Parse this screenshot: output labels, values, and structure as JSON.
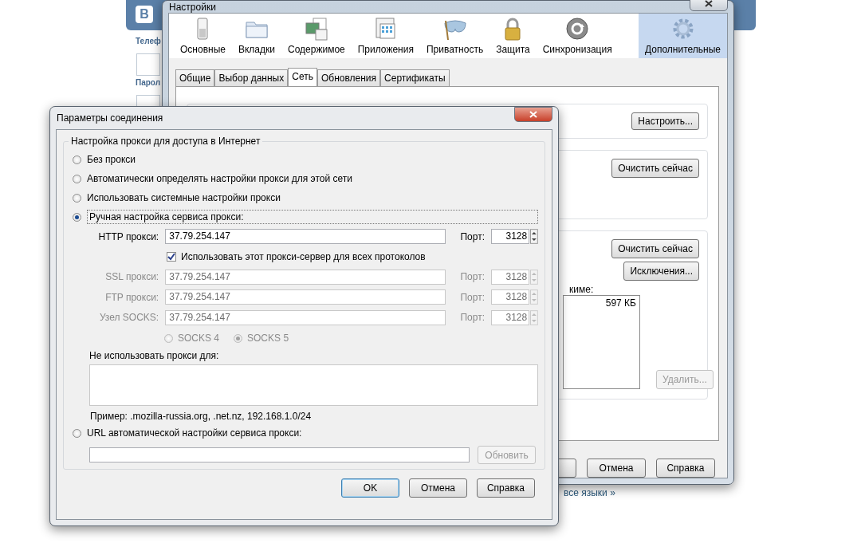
{
  "background_page": {
    "logo": "В",
    "phone_label": "Телеф",
    "password_label": "Парол",
    "languages_link": "все языки »"
  },
  "settings_window": {
    "title": "Настройки",
    "categories": [
      {
        "label": "Основные",
        "selected": false
      },
      {
        "label": "Вкладки",
        "selected": false
      },
      {
        "label": "Содержимое",
        "selected": false
      },
      {
        "label": "Приложения",
        "selected": false
      },
      {
        "label": "Приватность",
        "selected": false
      },
      {
        "label": "Защита",
        "selected": false
      },
      {
        "label": "Синхронизация",
        "selected": false
      },
      {
        "label": "Дополнительные",
        "selected": true
      }
    ],
    "tabs": [
      {
        "label": "Общие",
        "selected": false
      },
      {
        "label": "Выбор данных",
        "selected": false
      },
      {
        "label": "Сеть",
        "selected": true
      },
      {
        "label": "Обновления",
        "selected": false
      },
      {
        "label": "Сертификаты",
        "selected": false
      }
    ],
    "connection_button": "Настроить...",
    "cache_button": "Очистить сейчас",
    "offline_clear_button": "Очистить сейчас",
    "exceptions_button": "Исключения...",
    "offline_label": "киме:",
    "offline_list": {
      "size": "597 КБ"
    },
    "remove_button": {
      "label": "Удалить...",
      "disabled": true
    },
    "footer_buttons": [
      "Отмена",
      "Справка"
    ]
  },
  "connection_dialog": {
    "title": "Параметры соединения",
    "group_title": "Настройка прокси для доступа в Интернет",
    "modes": [
      {
        "label": "Без прокси",
        "selected": false
      },
      {
        "label": "Автоматически определять настройки прокси для этой сети",
        "selected": false
      },
      {
        "label": "Использовать системные настройки прокси",
        "selected": false
      },
      {
        "label": "Ручная настройка сервиса прокси:",
        "selected": true
      }
    ],
    "proxies": [
      {
        "label": "HTTP прокси:",
        "value": "37.79.254.147",
        "port_label": "Порт:",
        "port": "3128",
        "disabled": false
      }
    ],
    "same_proxy": {
      "label": "Использовать этот прокси-сервер для всех протоколов",
      "checked": true
    },
    "other_proxies": [
      {
        "label": "SSL прокси:",
        "value": "37.79.254.147",
        "port_label": "Порт:",
        "port": "3128",
        "disabled": true
      },
      {
        "label": "FTP прокси:",
        "value": "37.79.254.147",
        "port_label": "Порт:",
        "port": "3128",
        "disabled": true
      },
      {
        "label": "Узел SOCKS:",
        "value": "37.79.254.147",
        "port_label": "Порт:",
        "port": "3128",
        "disabled": true
      }
    ],
    "socks_versions": [
      {
        "label": "SOCKS 4",
        "selected": false
      },
      {
        "label": "SOCKS 5",
        "selected": true
      }
    ],
    "socks_disabled": true,
    "no_proxy_label": "Не использовать прокси для:",
    "example": "Пример: .mozilla-russia.org, .net.nz, 192.168.1.0/24",
    "auto_url": {
      "label": "URL автоматической настройки сервиса прокси:",
      "selected": false
    },
    "reload_button": {
      "label": "Обновить",
      "disabled": true
    },
    "buttons": [
      {
        "label": "OK",
        "default": true
      },
      {
        "label": "Отмена",
        "default": false
      },
      {
        "label": "Справка",
        "default": false
      }
    ]
  }
}
